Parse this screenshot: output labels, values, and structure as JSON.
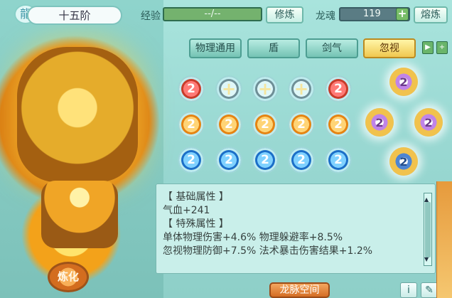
{
  "title": "十五阶",
  "header": {
    "exp_label": "经验",
    "exp_value": "--/--",
    "cultivate_button": "修炼",
    "dragon_soul_label": "龙魂",
    "dragon_soul_value": "119",
    "smelt_button": "熔炼"
  },
  "tabs": [
    "物理通用",
    "盾",
    "剑气",
    "忽视"
  ],
  "active_tab": "忽视",
  "gems": [
    {
      "type": "red",
      "symbol": "2"
    },
    {
      "type": "empty",
      "symbol": "+"
    },
    {
      "type": "empty",
      "symbol": "+"
    },
    {
      "type": "empty",
      "symbol": "+"
    },
    {
      "type": "red",
      "symbol": "2"
    },
    {
      "type": "orange",
      "symbol": "2"
    },
    {
      "type": "orange",
      "symbol": "2"
    },
    {
      "type": "orange",
      "symbol": "2"
    },
    {
      "type": "orange",
      "symbol": "2"
    },
    {
      "type": "orange",
      "symbol": "2"
    },
    {
      "type": "blue",
      "symbol": "2"
    },
    {
      "type": "blue",
      "symbol": "2"
    },
    {
      "type": "blue",
      "symbol": "2"
    },
    {
      "type": "blue",
      "symbol": "2"
    },
    {
      "type": "blue",
      "symbol": "2"
    }
  ],
  "attributes": {
    "basic_title": "【 基础属性 】",
    "basic_line": "气血+241",
    "special_title": "【 特殊属性 】",
    "special_line1": "单体物理伤害+4.6%  物理躲避率+8.5%",
    "special_line2": "忽视物理防御+7.5%  法术暴击伤害结果+1.2%"
  },
  "buttons": {
    "refine": "炼化",
    "dragon_space": "龙脉空间"
  }
}
